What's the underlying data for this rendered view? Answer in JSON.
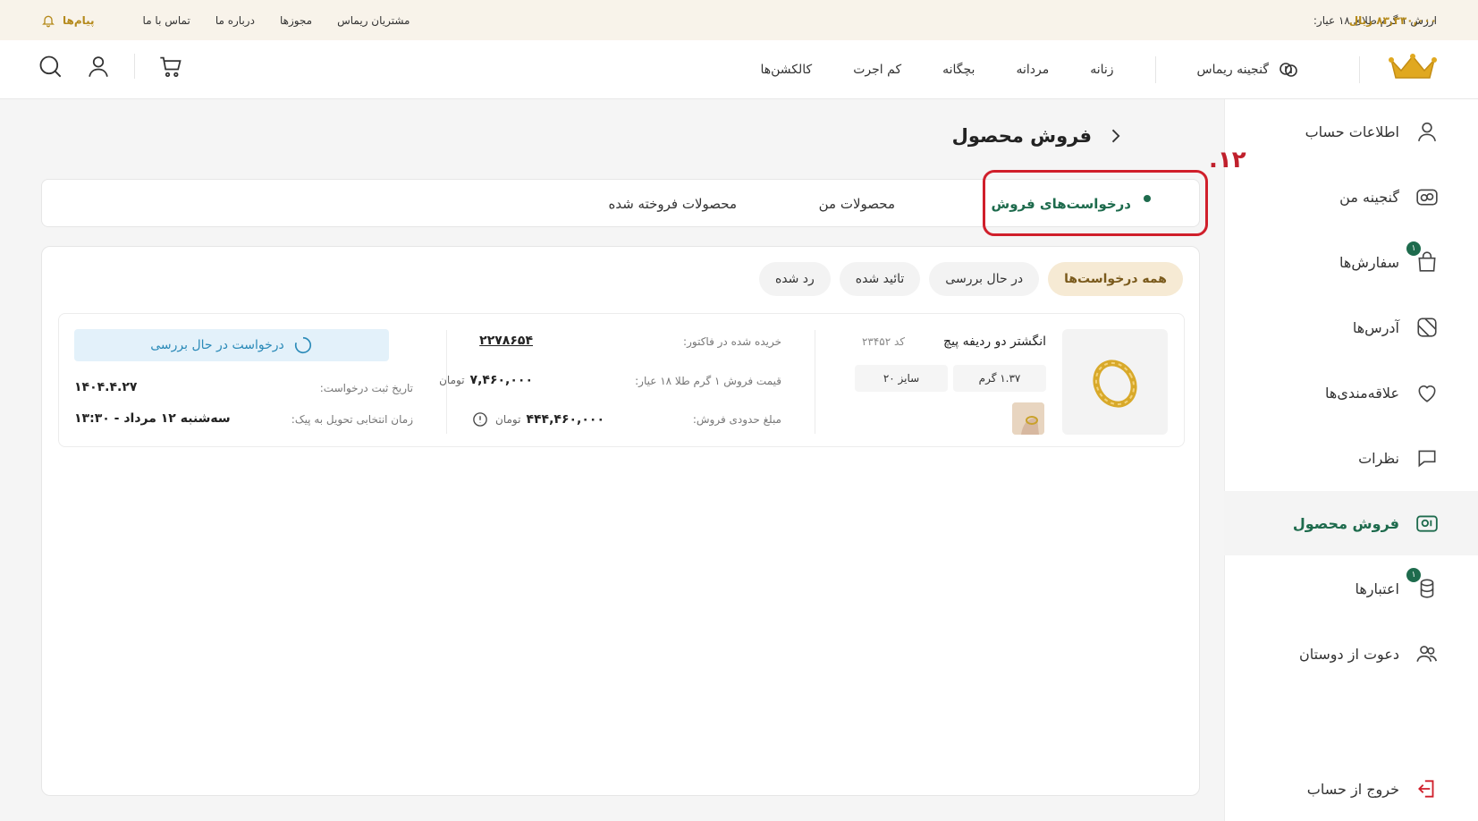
{
  "topbar": {
    "gold_price_label": "ارزش ۱ گرم طلای ۱۸ عیار:",
    "gold_price_value": "۸۳,۳۳۰,۰۰۰ ریال",
    "links": [
      "مشتریان ریماس",
      "مجوزها",
      "درباره ما",
      "تماس با ما"
    ],
    "messages_label": "پیام‌ها"
  },
  "header": {
    "nav": [
      "زنانه",
      "مردانه",
      "بچگانه",
      "کم اجرت",
      "کالکشن‌ها"
    ],
    "treasure_label": "گنجینه ریماس",
    "icons": [
      "search-icon",
      "user-icon",
      "cart-icon"
    ]
  },
  "sidebar": {
    "items": [
      {
        "label": "اطلاعات حساب",
        "icon": "user-icon"
      },
      {
        "label": "گنجینه من",
        "icon": "treasure-icon"
      },
      {
        "label": "سفارش‌ها",
        "icon": "bag-icon",
        "badge": "۱"
      },
      {
        "label": "آدرس‌ها",
        "icon": "map-icon"
      },
      {
        "label": "علاقه‌مندی‌ها",
        "icon": "heart-icon"
      },
      {
        "label": "نظرات",
        "icon": "comment-icon"
      },
      {
        "label": "فروش محصول",
        "icon": "sell-icon",
        "active": true
      },
      {
        "label": "اعتبارها",
        "icon": "coins-icon",
        "badge": "۱"
      },
      {
        "label": "دعوت از دوستان",
        "icon": "friends-icon"
      }
    ],
    "logout_label": "خروج از حساب"
  },
  "main": {
    "title": "فروش محصول",
    "tabs": [
      "درخواست‌های فروش",
      "محصولات من",
      "محصولات فروخته شده"
    ],
    "step_number": ".۱۲",
    "filters": [
      "همه درخواست‌ها",
      "در حال بررسی",
      "تائید شده",
      "رد شده"
    ],
    "request": {
      "product_name": "انگشتر دو ردیفه پیچ",
      "product_code": "کد ۲۳۴۵۲",
      "weight": "۱.۳۷ گرم",
      "size": "سایز ۲۰",
      "invoice_label": "خریده شده در فاکتور:",
      "invoice_value": "۲۲۷۸۶۵۴",
      "unit_price_label": "قیمت فروش ۱ گرم طلا ۱۸ عیار:",
      "unit_price_value": "۷,۴۶۰,۰۰۰",
      "currency": "تومان",
      "approx_label": "مبلغ حدودی فروش:",
      "approx_value": "۴۴۴,۴۶۰,۰۰۰",
      "status": "درخواست در حال بررسی",
      "date_label": "تاریخ ثبت درخواست:",
      "date_value": "۱۴۰۴.۴.۲۷",
      "delivery_label": "زمان انتخابی تحویل به پیک:",
      "delivery_value": "سه‌شنبه ۱۲ مرداد - ۱۳:۳۰"
    }
  },
  "colors": {
    "brand_green": "#1e6b4d",
    "gold": "#b58a1c",
    "highlight_red": "#d01f2b",
    "status_blue": "#2a8ab8"
  }
}
